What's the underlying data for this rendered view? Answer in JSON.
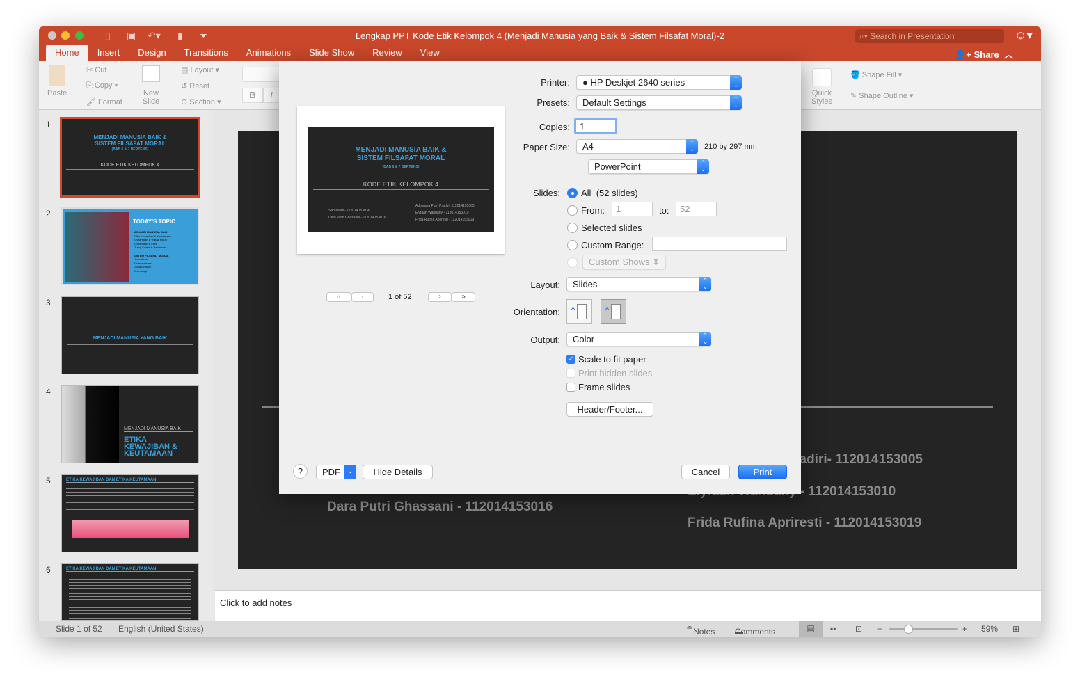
{
  "window": {
    "title": "Lengkap PPT Kode Etik Kelompok 4 (Menjadi Manusia yang Baik & Sistem Filsafat Moral)-2",
    "search_placeholder": "Search in Presentation",
    "share": "Share"
  },
  "tabs": [
    "Home",
    "Insert",
    "Design",
    "Transitions",
    "Animations",
    "Slide Show",
    "Review",
    "View"
  ],
  "ribbon": {
    "paste": "Paste",
    "cut": "Cut",
    "copy": "Copy",
    "format": "Format",
    "new_slide_1": "New",
    "new_slide_2": "Slide",
    "layout": "Layout",
    "reset": "Reset",
    "section": "Section",
    "bold": "B",
    "italic": "I",
    "quick_styles_1": "Quick",
    "quick_styles_2": "Styles",
    "shape_fill": "Shape Fill",
    "shape_outline": "Shape Outline"
  },
  "thumbnails": [
    {
      "num": "1",
      "title1": "MENJADI MANUSIA BAIK &",
      "title2": "SISTEM FILSAFAT MORAL",
      "sub": "(BAB 6 & 7 BERTENS)",
      "heading": "KODE ETIK KELOMPOK 4"
    },
    {
      "num": "2",
      "title": "TODAY'S TOPIC",
      "sec1": "MENJADI MANUSIA BAIK",
      "items1": [
        "Etika Kewajiban & Keutamaan",
        "Keutamaan & Watak Moral",
        "Keutamaan & Etos",
        "Orang Kudus & Pahlawan"
      ],
      "sec2": "SISTEM FILSAFAT MORAL",
      "items2": [
        "Hedonisme",
        "Eudemonisme",
        "Utilitarianisme",
        "Deontologi"
      ]
    },
    {
      "num": "3",
      "title": "MENJADI MANUSIA YANG BAIK"
    },
    {
      "num": "4",
      "sub": "MENJADI MANUSIA BAIK",
      "title": "ETIKA KEWAJIBAN & KEUTAMAAN"
    },
    {
      "num": "5",
      "title": "ETIKA KEWAJIBAN DAN ETIKA KEUTAMAAN"
    },
    {
      "num": "6",
      "title": "ETIKA KEWAJIBAN DAN ETIKA KEUTAMAAN"
    }
  ],
  "slide": {
    "title1": "MENJADI MANUSIA BAIK &",
    "title2": "SISTEM FILSAFAT MORAL",
    "sub": "(BAB 6 & 7 BERTENS)",
    "heading": "KODE ETIK KELOMPOK 4",
    "left_names": [
      "Saraswati - 112014153036",
      "Dara Putri Ghassani - 112014153016"
    ],
    "right_names": [
      "Adismara Putri Pradiri- 112014153005",
      "Elyfaah Wandany - 112014153010",
      "Frida Rufina Apriresti - 112014153019"
    ]
  },
  "notes_placeholder": "Click to add notes",
  "status": {
    "slide": "Slide 1 of 52",
    "language": "English (United States)",
    "notes": "Notes",
    "comments": "Comments",
    "zoom": "59%",
    "zoom_level": 59
  },
  "print": {
    "printer_label": "Printer:",
    "printer": "HP Deskjet 2640 series",
    "presets_label": "Presets:",
    "presets": "Default Settings",
    "copies_label": "Copies:",
    "copies": "1",
    "paper_label": "Paper Size:",
    "paper": "A4",
    "paper_dims": "210 by 297 mm",
    "app_menu": "PowerPoint",
    "slides_label": "Slides:",
    "all": "All",
    "all_count": "(52 slides)",
    "from": "From:",
    "from_val": "1",
    "to": "to:",
    "to_val": "52",
    "selected": "Selected slides",
    "custom_range": "Custom Range:",
    "custom_shows": "Custom Shows",
    "layout_label": "Layout:",
    "layout": "Slides",
    "orientation_label": "Orientation:",
    "output_label": "Output:",
    "output": "Color",
    "scale": "Scale to fit paper",
    "scale_checked": true,
    "hidden": "Print hidden slides",
    "hidden_checked": false,
    "frame": "Frame slides",
    "frame_checked": false,
    "header_footer": "Header/Footer...",
    "page": "1 of 52",
    "help": "?",
    "pdf": "PDF",
    "hide_details": "Hide Details",
    "cancel": "Cancel",
    "print": "Print"
  }
}
